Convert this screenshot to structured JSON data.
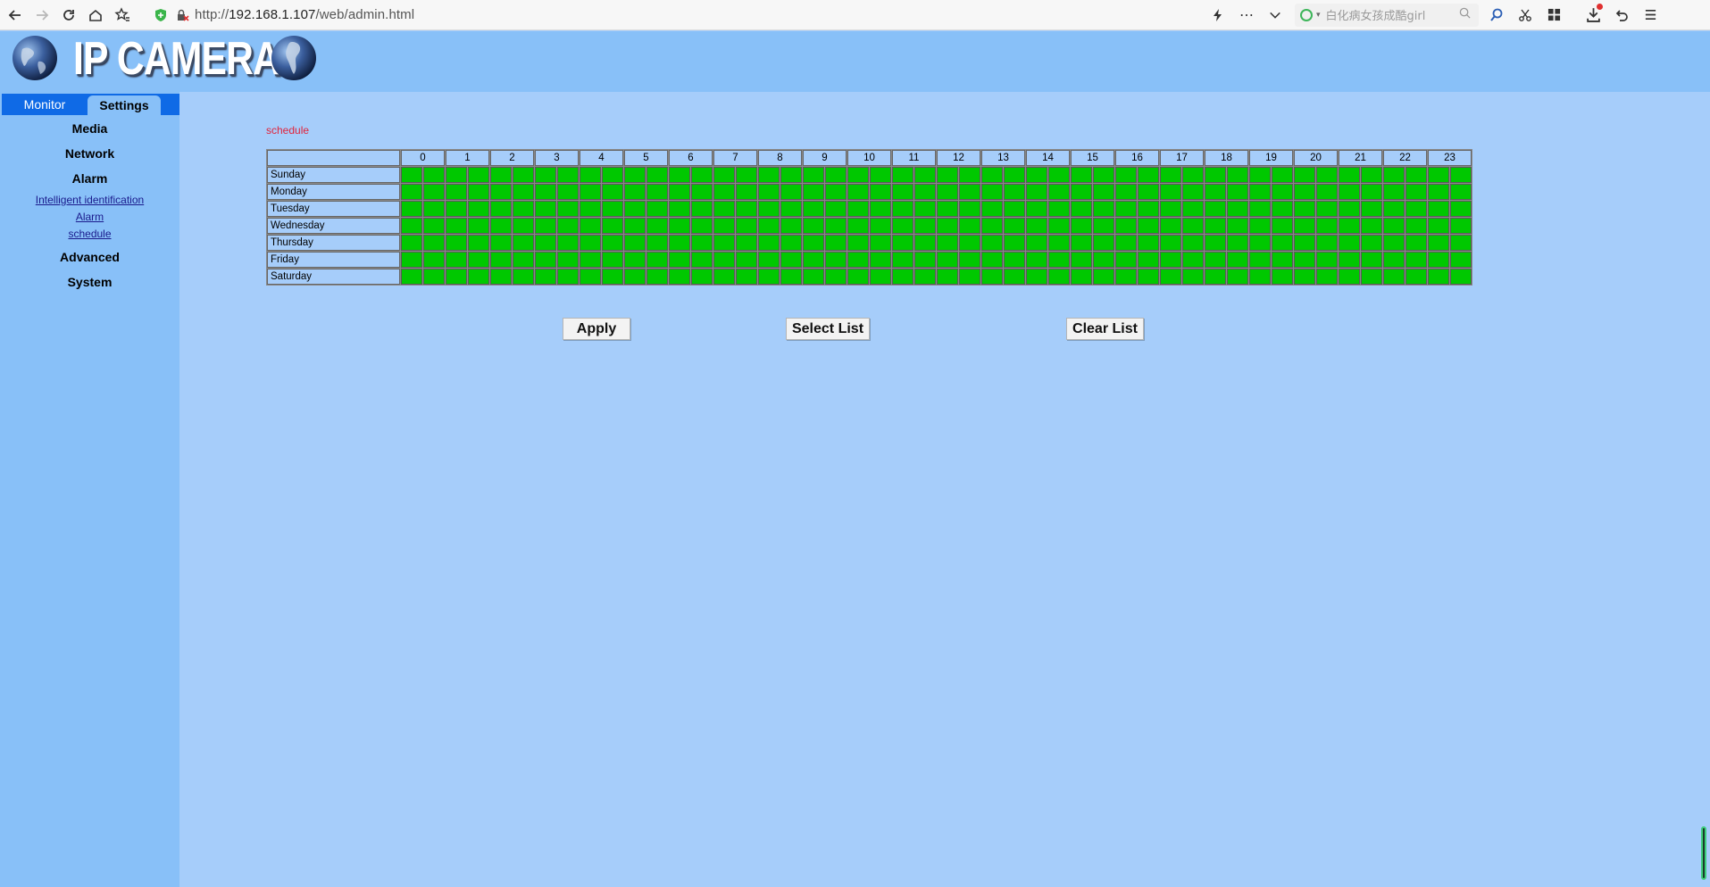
{
  "browser": {
    "url_prefix": "http://",
    "url_host": "192.168.1.107",
    "url_path": "/web/admin.html",
    "search_placeholder": "白化病女孩成酷girl"
  },
  "header": {
    "logo_text": "IP CAMERA"
  },
  "sidebar": {
    "tabs": [
      {
        "label": "Monitor",
        "active": false
      },
      {
        "label": "Settings",
        "active": true
      }
    ],
    "menu": {
      "media": "Media",
      "network": "Network",
      "alarm": "Alarm",
      "alarm_sub": [
        "Intelligent identification",
        "Alarm",
        "schedule"
      ],
      "advanced": "Advanced",
      "system": "System"
    }
  },
  "content": {
    "title": "schedule",
    "hours": [
      "0",
      "1",
      "2",
      "3",
      "4",
      "5",
      "6",
      "7",
      "8",
      "9",
      "10",
      "11",
      "12",
      "13",
      "14",
      "15",
      "16",
      "17",
      "18",
      "19",
      "20",
      "21",
      "22",
      "23"
    ],
    "days": [
      "Sunday",
      "Monday",
      "Tuesday",
      "Wednesday",
      "Thursday",
      "Friday",
      "Saturday"
    ],
    "half_hour_slots_per_day": 48,
    "all_slots_selected": true,
    "selected_color": "#00c800",
    "buttons": {
      "apply": "Apply",
      "select_list": "Select List",
      "clear_list": "Clear List"
    }
  },
  "colors": {
    "page_bg": "#a6cdfa",
    "header_bg": "#88c0f8",
    "tab_bar": "#0f6ae6",
    "title_red": "#e0243c"
  }
}
